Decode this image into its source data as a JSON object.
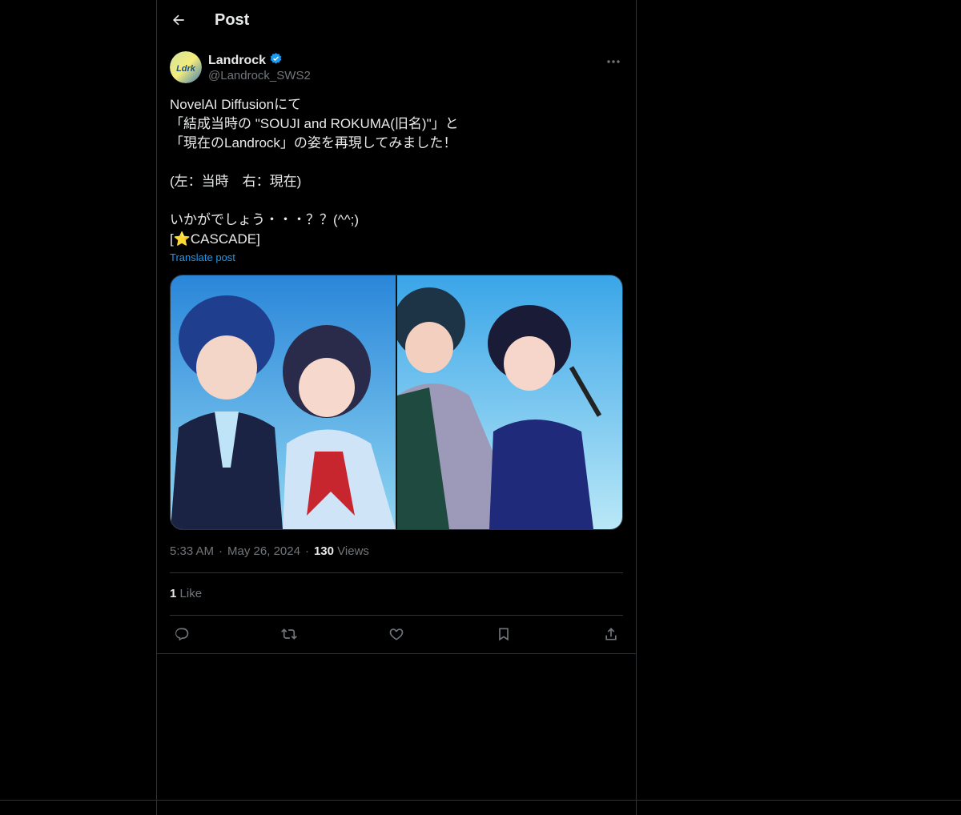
{
  "header": {
    "title": "Post",
    "back_icon": "arrow-left-icon"
  },
  "author": {
    "display_name": "Landrock",
    "handle": "@Landrock_SWS2",
    "verified": true,
    "verified_color": "#1d9bf0",
    "avatar_text": "Ldrk",
    "more_icon": "more-horizontal-icon"
  },
  "post": {
    "text": "NovelAI Diffusionにて\n「結成当時の \"SOUJI and ROKUMA(旧名)\"」と\n「現在のLandrock」の姿を再現してみました！\n\n(左：当時　右：現在)\n\nいかがでしょう・・・？？(^^;)\n[⭐CASCADE]",
    "translate_label": "Translate post"
  },
  "media": {
    "count": 2,
    "left_icon": "image-icon",
    "right_icon": "image-icon"
  },
  "meta": {
    "time": "5:33 AM",
    "date": "May 26, 2024",
    "separator": "·",
    "views_count": "130",
    "views_label": "Views"
  },
  "engagement": {
    "likes_count": "1",
    "likes_label": "Like"
  },
  "actions": {
    "reply_icon": "reply-icon",
    "repost_icon": "repost-icon",
    "like_icon": "heart-icon",
    "bookmark_icon": "bookmark-icon",
    "share_icon": "share-icon"
  },
  "colors": {
    "background": "#000000",
    "text": "#e7e9ea",
    "muted": "#71767b",
    "accent": "#1d9bf0",
    "border": "#2f3336"
  }
}
